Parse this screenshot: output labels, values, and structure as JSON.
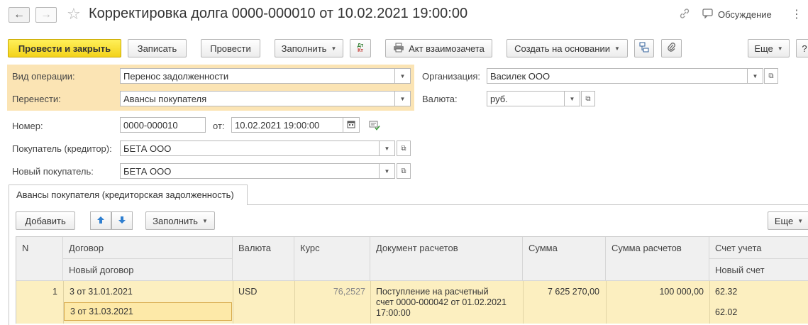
{
  "window": {
    "title": "Корректировка долга 0000-000010 от 10.02.2021 19:00:00",
    "discussion_label": "Обсуждение"
  },
  "icons": {
    "back": "arrow-left-icon",
    "forward": "arrow-right-icon",
    "favorite": "star-icon",
    "link": "link-icon",
    "discussion": "chat-bubble-icon",
    "more": "vertical-dots-icon"
  },
  "toolbar": {
    "post_and_close": "Провести и закрыть",
    "save": "Записать",
    "post": "Провести",
    "fill": "Заполнить",
    "dt_kt": "Дт Кт",
    "offset_act": "Акт взаимозачета",
    "create_based": "Создать на основании",
    "more": "Еще",
    "help": "?"
  },
  "form": {
    "operation_label": "Вид операции:",
    "operation_value": "Перенос задолженности",
    "transfer_label": "Перенести:",
    "transfer_value": "Авансы покупателя",
    "org_label": "Организация:",
    "org_value": "Василек ООО",
    "currency_label": "Валюта:",
    "currency_value": "руб.",
    "number_label": "Номер:",
    "number_value": "0000-000010",
    "date_label": "от:",
    "date_value": "10.02.2021 19:00:00",
    "buyer_label": "Покупатель (кредитор):",
    "buyer_value": "БЕТА ООО",
    "new_buyer_label": "Новый покупатель:",
    "new_buyer_value": "БЕТА ООО"
  },
  "tab": {
    "label": "Авансы покупателя (кредиторская задолженность)"
  },
  "table_toolbar": {
    "add": "Добавить",
    "fill": "Заполнить",
    "more": "Еще"
  },
  "table": {
    "headers": {
      "n": "N",
      "contract": "Договор",
      "new_contract": "Новый договор",
      "currency": "Валюта",
      "rate": "Курс",
      "doc": "Документ расчетов",
      "sum": "Сумма",
      "sum_calc": "Сумма расчетов",
      "account": "Счет учета",
      "new_account": "Новый счет"
    },
    "rows": [
      {
        "n": "1",
        "contract": "3 от 31.01.2021",
        "new_contract": "3 от 31.03.2021",
        "currency": "USD",
        "rate": "76,2527",
        "doc_line1": "Поступление на расчетный",
        "doc_line2": "счет 0000-000042 от 01.02.2021",
        "doc_line3": "17:00:00",
        "sum": "7 625 270,00",
        "sum_calc": "100 000,00",
        "account": "62.32",
        "new_account": "62.02"
      }
    ]
  }
}
